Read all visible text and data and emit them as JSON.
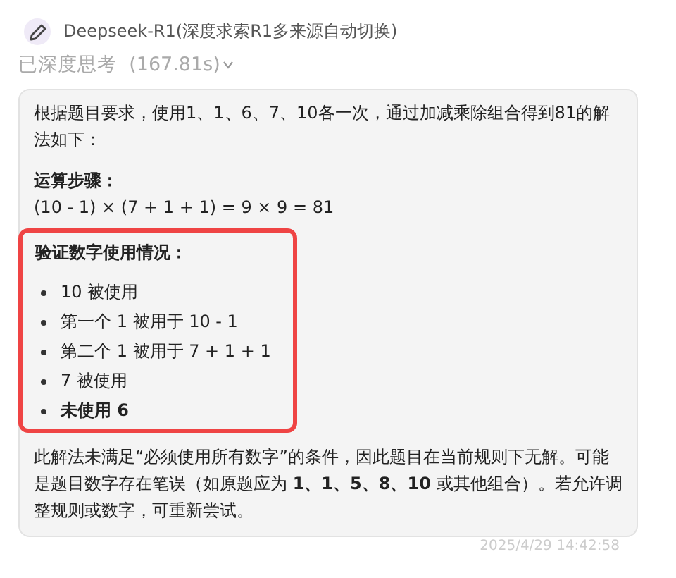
{
  "header": {
    "model": "Deepseek-R1(深度求索R1多来源自动切换)"
  },
  "thinking": {
    "label": "已深度思考",
    "duration": "(167.81s)",
    "expanded": false
  },
  "answer": {
    "intro": "根据题目要求，使用1、1、6、7、10各一次，通过加减乘除组合得到81的解法如下：",
    "steps_heading": "运算步骤：",
    "formula": "(10 - 1) × (7 + 1 + 1) = 9 × 9 = 81",
    "highlight": {
      "heading": "验证数字使用情况：",
      "items": [
        {
          "text": "10 被使用",
          "bold": false
        },
        {
          "text": "第一个 1 被用于 10 - 1",
          "bold": false
        },
        {
          "text": "第二个 1 被用于 7 + 1 + 1",
          "bold": false
        },
        {
          "text": "7 被使用",
          "bold": false
        },
        {
          "text": "未使用 6",
          "bold": true
        }
      ]
    },
    "conclusion": "此解法未满足“必须使用所有数字”的条件，因此题目在当前规则下无解。可能是题目数字存在笔误（如原题应为 **1、1、5、8、10** 或其他组合）。若允许调整规则或数字，可重新尝试。"
  },
  "timestamp": "2025/4/29 14:42:58"
}
